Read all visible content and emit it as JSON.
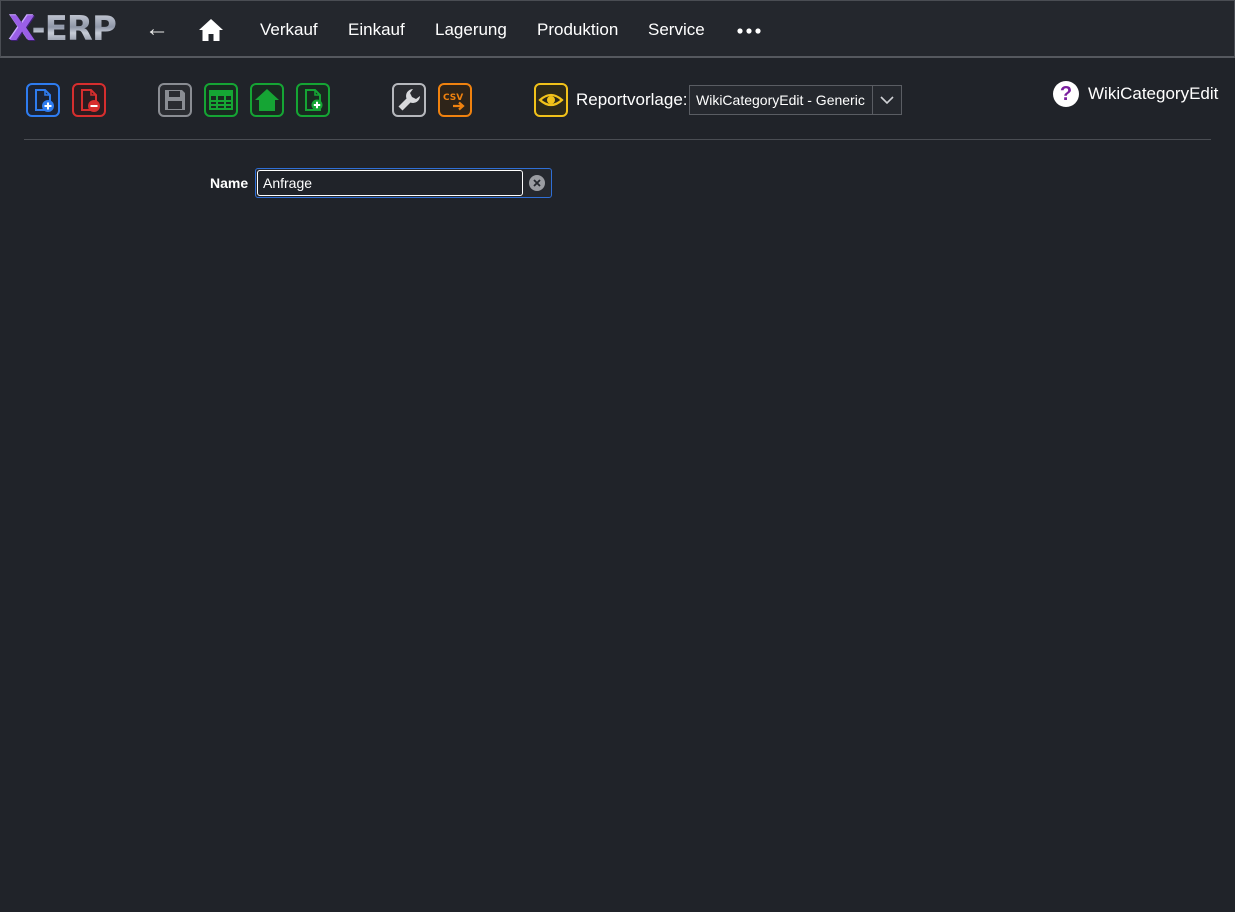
{
  "app": {
    "logo_x": "X",
    "logo_rest": "-ERP"
  },
  "nav": {
    "back": "←",
    "items": [
      {
        "label": "Verkauf"
      },
      {
        "label": "Einkauf"
      },
      {
        "label": "Lagerung"
      },
      {
        "label": "Produktion"
      },
      {
        "label": "Service"
      }
    ]
  },
  "toolbar": {
    "buttons": [
      {
        "icon": "new-document-icon",
        "color": "#2e7cf0"
      },
      {
        "icon": "delete-document-icon",
        "color": "#d72e2e"
      },
      {
        "icon": "save-icon",
        "color": "#8a8d93"
      },
      {
        "icon": "table-icon",
        "color": "#15a534"
      },
      {
        "icon": "home-up-icon",
        "color": "#15a534"
      },
      {
        "icon": "add-document-icon",
        "color": "#15a534"
      },
      {
        "icon": "wrench-icon",
        "color": "#b6b8bd"
      },
      {
        "icon": "csv-export-icon",
        "color": "#f0820f"
      },
      {
        "icon": "preview-eye-icon",
        "color": "#f2c21a"
      }
    ],
    "csv_text": "CSV",
    "report_label": "Reportvorlage:",
    "report_value": "WikiCategoryEdit - Generic"
  },
  "help": {
    "symbol": "?",
    "title": "WikiCategoryEdit"
  },
  "form": {
    "name_label": "Name",
    "name_value": "Anfrage"
  }
}
